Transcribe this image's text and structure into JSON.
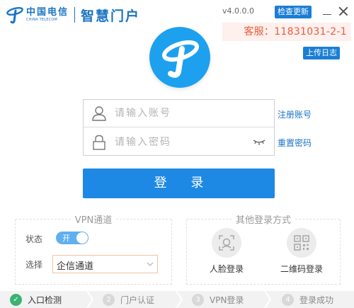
{
  "brand": {
    "name_cn": "中国电信",
    "name_en": "CHINA TELECOM",
    "app_title": "智慧门户"
  },
  "header": {
    "version": "v4.0.0.0",
    "update_button": "检查更新",
    "service_text": "客服：11831031-2-1",
    "upload_log_button": "上传日志"
  },
  "login": {
    "account_placeholder": "请输入账号",
    "password_placeholder": "请输入密码",
    "register_link": "注册账号",
    "reset_link": "重置密码",
    "login_button": "登 录"
  },
  "vpn": {
    "title": "VPN通道",
    "status_label": "状态",
    "toggle_text": "开",
    "toggle_on": true,
    "select_label": "选择",
    "select_value": "企信通道"
  },
  "other_login": {
    "title": "其他登录方式",
    "options": [
      {
        "label": "人脸登录",
        "icon": "face-scan-icon"
      },
      {
        "label": "二维码登录",
        "icon": "qr-code-icon"
      }
    ]
  },
  "steps": [
    {
      "num": "✓",
      "label": "入口检测",
      "done": true
    },
    {
      "num": "2",
      "label": "门户认证",
      "done": false
    },
    {
      "num": "3",
      "label": "VPN登录",
      "done": false
    },
    {
      "num": "4",
      "label": "登录成功",
      "done": false
    }
  ],
  "colors": {
    "brand_blue": "#1a74c4",
    "button_blue": "#1e88e5",
    "service_red": "#ec5a3f",
    "step_done_green": "#3cb371"
  }
}
